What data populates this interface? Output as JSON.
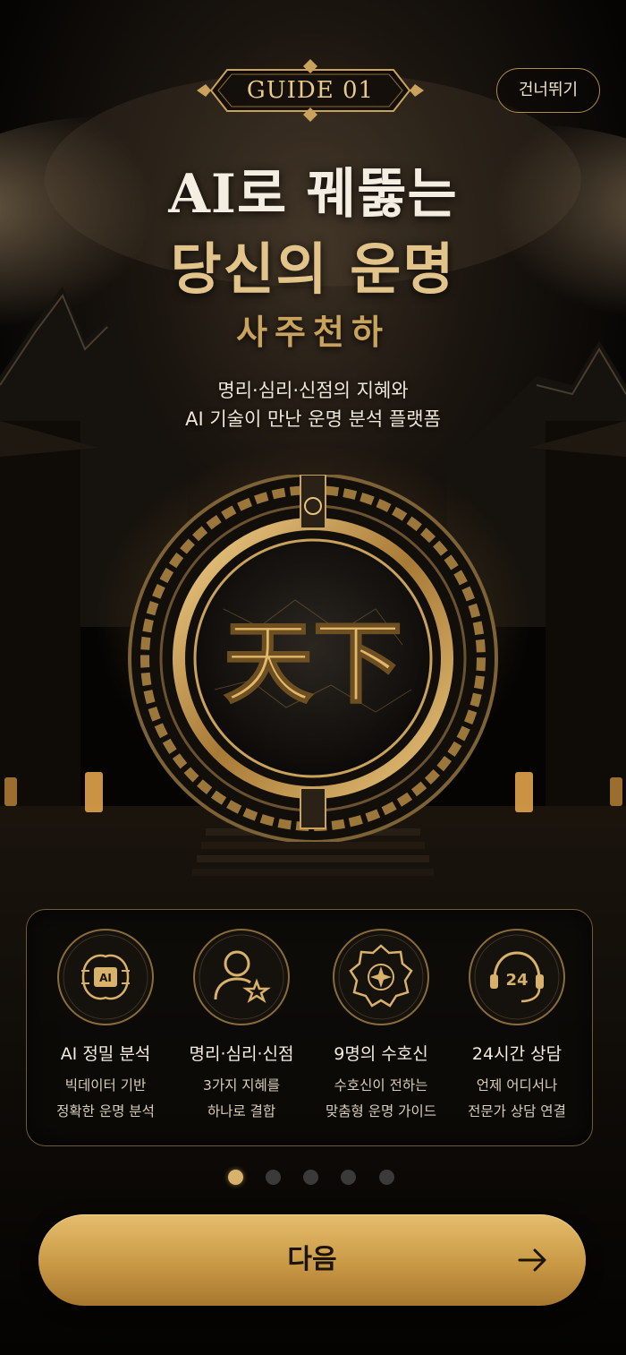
{
  "header": {
    "guide_label": "GUIDE 01",
    "skip_label": "건너뛰기"
  },
  "hero": {
    "title_line1": "AI로 꿰뚫는",
    "title_line2": "당신의 운명",
    "brand": "사주천하",
    "subtitle_line1": "명리·심리·신점의 지혜와",
    "subtitle_line2": "AI 기술이 만난 운명 분석 플랫폼",
    "gate_text": "天下"
  },
  "features": [
    {
      "icon": "ai-brain-icon",
      "title": "AI 정밀 분석",
      "desc1": "빅데이터 기반",
      "desc2": "정확한 운명 분석"
    },
    {
      "icon": "person-star-icon",
      "title": "명리·심리·신점",
      "desc1": "3가지 지혜를",
      "desc2": "하나로 결합"
    },
    {
      "icon": "guardian-emblem-icon",
      "title": "9명의 수호신",
      "desc1": "수호신이 전하는",
      "desc2": "맞춤형 운명 가이드"
    },
    {
      "icon": "headset-24-icon",
      "title": "24시간 상담",
      "desc1": "언제 어디서나",
      "desc2": "전문가 상담 연결"
    }
  ],
  "feature_icon_text": {
    "ai": "AI",
    "hours": "24"
  },
  "pagination": {
    "total": 5,
    "active": 1
  },
  "footer": {
    "next_label": "다음"
  },
  "colors": {
    "accent_gold": "#d8b16a",
    "background": "#050403",
    "text_light": "#f1ebe0"
  }
}
